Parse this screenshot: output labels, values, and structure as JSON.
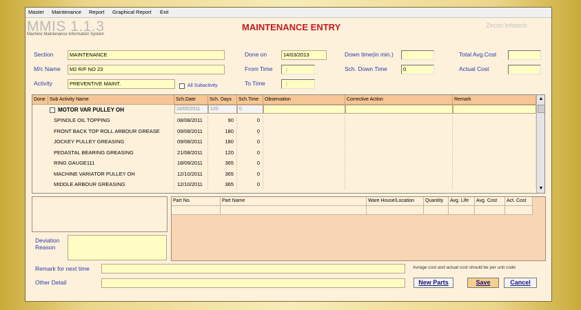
{
  "menu": [
    "Master",
    "Maintenance",
    "Report",
    "Graphical Report",
    "Exit"
  ],
  "app": {
    "logo": "MMIS 1.1.3",
    "subtitle": "Machine Maintenance Information System",
    "title": "MAINTENANCE ENTRY",
    "company": "Zircon Infotech"
  },
  "form": {
    "section_label": "Section",
    "section_value": "MAINTENANCE",
    "machine_label": "M/c Name",
    "machine_value": "M2 R/F NO 23",
    "activity_label": "Activity",
    "activity_value": "PREVENTIVE MAINT.",
    "all_subactivity_label": "All Subactivity",
    "done_on_label": "Done on",
    "done_on_value": "14/03/2013",
    "from_time_label": "From Time",
    "from_time_value": ":",
    "to_time_label": "To Time",
    "to_time_value": ":",
    "downtime_label": "Down time(in min.)",
    "downtime_value": "",
    "sch_downtime_label": "Sch. Down Time",
    "sch_downtime_value": "0",
    "total_avg_cost_label": "Total Avg.Cost",
    "total_avg_cost_value": "",
    "actual_cost_label": "Actual Cost",
    "actual_cost_value": ""
  },
  "grid": {
    "headers": [
      "Done",
      "Sub Activity Name",
      "Sch.Date",
      "Sch. Days",
      "Sch.Time",
      "Observation",
      "Corrective Action",
      "Remark"
    ],
    "edit_row": {
      "name": "MOTOR  VAR PULLEY OH",
      "date": "16/05/2011",
      "days": "120",
      "time": "0"
    },
    "rows": [
      {
        "name": "SPINDLE OIL TOPPING",
        "date": "08/08/2011",
        "days": "90",
        "time": "0"
      },
      {
        "name": "FRONT BACK TOP ROLL ARBOUR GREASE",
        "date": "09/08/2011",
        "days": "180",
        "time": "0"
      },
      {
        "name": "JOCKEY PULLEY GREASING",
        "date": "09/08/2011",
        "days": "180",
        "time": "0"
      },
      {
        "name": "PEDASTAL BEARING GREASING",
        "date": "21/08/2011",
        "days": "120",
        "time": "0"
      },
      {
        "name": "RING GAUGE111",
        "date": "18/09/2011",
        "days": "365",
        "time": "0"
      },
      {
        "name": "MACHINE VARIATOR  PULLEY OH",
        "date": "12/10/2011",
        "days": "365",
        "time": "0"
      },
      {
        "name": "MIDDLE ARBOUR GREASING",
        "date": "12/10/2011",
        "days": "365",
        "time": "0"
      }
    ]
  },
  "parts": {
    "headers": [
      "Part No.",
      "Part Name",
      "Ware House/Location",
      "Quantity",
      "Avg. Life",
      "Avg. Cost",
      "Act. Cost"
    ]
  },
  "deviation": {
    "label_line1": "Deviation",
    "label_line2": "Reason",
    "value": ""
  },
  "remark_next": {
    "label": "Remark for next time",
    "value": ""
  },
  "other_detail": {
    "label": "Other Detail",
    "value": ""
  },
  "note": "Avrage cost and actual cost should be per unit code",
  "buttons": {
    "new_parts": "New Parts",
    "save": "Save",
    "cancel": "Cancel"
  }
}
